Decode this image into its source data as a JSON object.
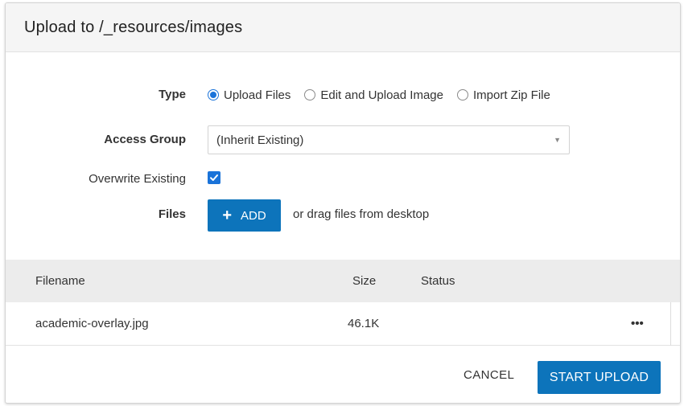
{
  "dialog": {
    "title": "Upload to /_resources/images"
  },
  "form": {
    "type_label": "Type",
    "type_options": [
      "Upload Files",
      "Edit and Upload Image",
      "Import Zip File"
    ],
    "type_selected": "Upload Files",
    "access_group_label": "Access Group",
    "access_group_value": "(Inherit Existing)",
    "overwrite_label": "Overwrite Existing",
    "overwrite_checked": true,
    "files_label": "Files",
    "add_button_label": "ADD",
    "drag_hint": "or drag files from desktop"
  },
  "table": {
    "columns": [
      "Filename",
      "Size",
      "Status"
    ],
    "rows": [
      {
        "filename": "academic-overlay.jpg",
        "size": "46.1K",
        "status": "",
        "menu": "•••"
      }
    ]
  },
  "footer": {
    "cancel_label": "CANCEL",
    "start_label": "START UPLOAD"
  },
  "colors": {
    "accent": "#0d74bb",
    "radio_checked": "#1a73d9",
    "header_bg": "#f5f5f5",
    "table_header_bg": "#ececec"
  },
  "icons": {
    "add": "plus-icon",
    "select_caret": "caret-down-icon",
    "row_menu": "more-horizontal-icon",
    "checkbox": "check-icon"
  }
}
